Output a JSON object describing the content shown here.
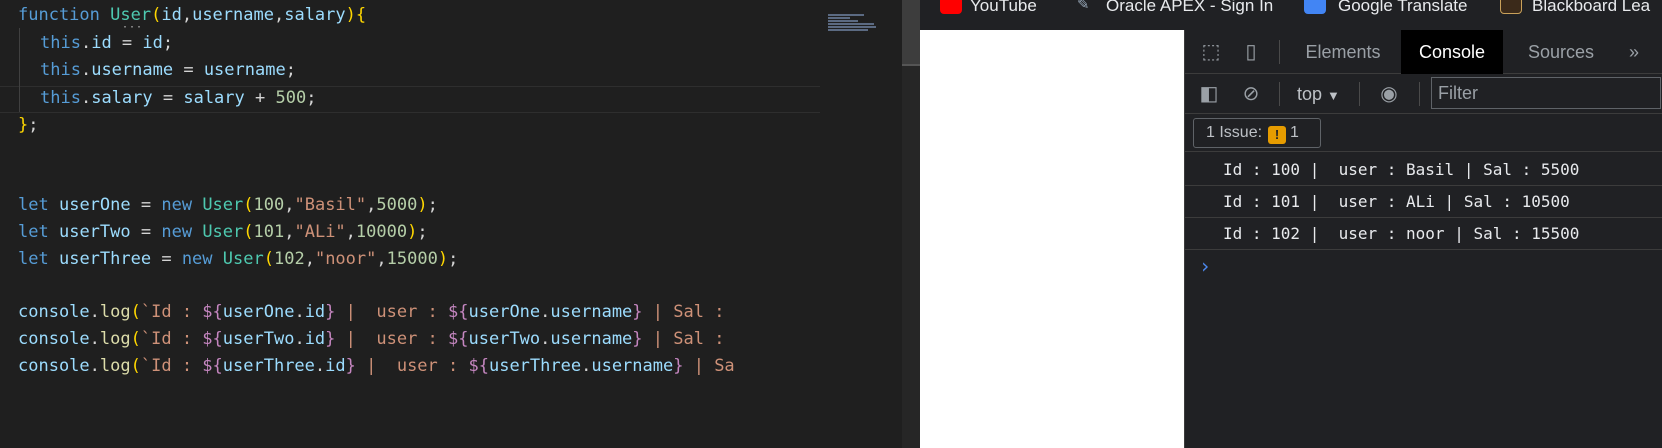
{
  "editor": {
    "lines": {
      "l1_kw": "function",
      "l1_fn": "User",
      "l1_p1": "id",
      "l1_p2": "username",
      "l1_p3": "salary",
      "this": "this",
      "id_prop": "id",
      "username_prop": "username",
      "salary_prop": "salary",
      "plus": "+",
      "n500": "500",
      "let": "let",
      "new": "new",
      "v1": "userOne",
      "v2": "userTwo",
      "v3": "userThree",
      "a1_id": "100",
      "a1_name": "\"Basil\"",
      "a1_sal": "5000",
      "a2_id": "101",
      "a2_name": "\"ALi\"",
      "a2_sal": "10000",
      "a3_id": "102",
      "a3_name": "\"noor\"",
      "a3_sal": "15000",
      "console": "console",
      "log": "log",
      "t_id": "`Id : ",
      "t_user": " |  user : ",
      "t_sal": " | Sal : ",
      "t_sa": " | Sa"
    }
  },
  "bookmarks": [
    {
      "label": "YouTube",
      "icon": "youtube-icon"
    },
    {
      "label": "Oracle APEX - Sign In",
      "icon": "apex-icon"
    },
    {
      "label": "Google Translate",
      "icon": "translate-icon"
    },
    {
      "label": "Blackboard Lea",
      "icon": "blackboard-icon"
    }
  ],
  "devtools": {
    "tabs": [
      "Elements",
      "Console",
      "Sources"
    ],
    "more": "»",
    "context": "top",
    "filter_placeholder": "Filter",
    "issues_label": "1 Issue:",
    "issues_count": "1",
    "logs": [
      "Id : 100 |  user : Basil | Sal : 5500",
      "Id : 101 |  user : ALi | Sal : 10500",
      "Id : 102 |  user : noor | Sal : 15500"
    ],
    "prompt": "›"
  },
  "colors": {
    "keyword": "#569cd6",
    "function": "#4ec9b0",
    "identifier": "#9cdcfe",
    "number": "#b5cea8",
    "string": "#ce9178",
    "template_interp": "#c586c0",
    "active_tab_bg": "#000000",
    "issue_badge": "#e69c00"
  }
}
